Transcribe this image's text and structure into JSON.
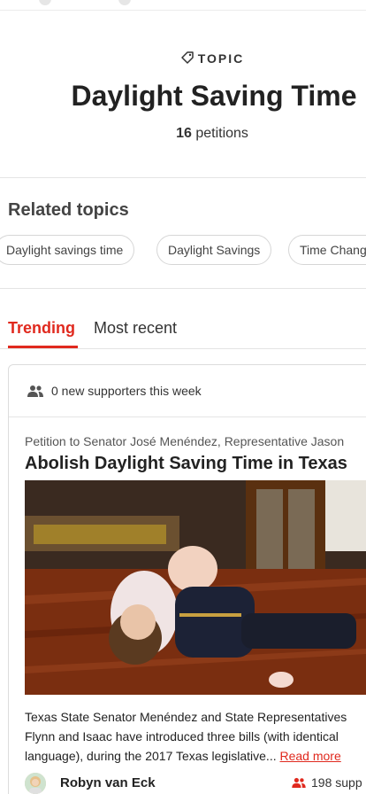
{
  "topic": {
    "label": "TOPIC",
    "title": "Daylight Saving Time",
    "count_number": "16",
    "count_suffix": " petitions"
  },
  "related": {
    "heading": "Related topics",
    "chips": [
      "Daylight savings time",
      "Daylight Savings",
      "Time Change"
    ]
  },
  "tabs": {
    "trending": "Trending",
    "recent": "Most recent"
  },
  "card": {
    "supporters_week": "0 new supporters this week",
    "petition_to": "Petition to Senator José Menéndez, Representative Jason",
    "title": "Abolish Daylight Saving Time in Texas",
    "summary_lines": [
      "Texas State Senator Menéndez and State Representatives",
      "Flynn and Isaac have introduced three bills (with identical",
      "language), during the 2017 Texas legislative... "
    ],
    "read_more": "Read more",
    "author": "Robyn van Eck",
    "supporters": "198 supp"
  },
  "colors": {
    "accent": "#e0291e",
    "text": "#222222",
    "border": "#dcdcdc"
  },
  "icons": {
    "topic": "tag-icon",
    "supporters": "people-icon"
  }
}
